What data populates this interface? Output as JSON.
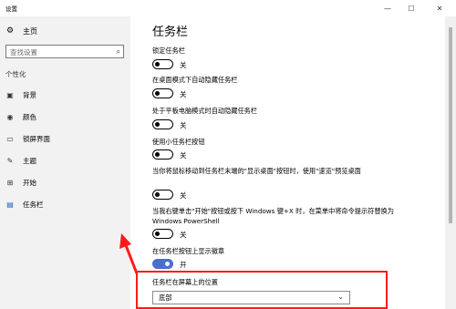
{
  "window": {
    "title": "设置"
  },
  "controls": {
    "minimize": "—",
    "maximize": "☐",
    "close": "✕"
  },
  "sidebar": {
    "home_label": "主页",
    "search_placeholder": "查找设置",
    "section": "个性化",
    "items": [
      {
        "label": "背景",
        "icon": "image-icon"
      },
      {
        "label": "颜色",
        "icon": "palette-icon"
      },
      {
        "label": "锁屏界面",
        "icon": "lock-screen-icon"
      },
      {
        "label": "主题",
        "icon": "theme-icon"
      },
      {
        "label": "开始",
        "icon": "start-icon"
      },
      {
        "label": "任务栏",
        "icon": "taskbar-icon",
        "active": true
      }
    ]
  },
  "main": {
    "title": "任务栏",
    "options": [
      {
        "label": "锁定任务栏",
        "state": "关",
        "on": false
      },
      {
        "label": "在桌面模式下自动隐藏任务栏",
        "state": "关",
        "on": false
      },
      {
        "label": "处于平板电脑模式时自动隐藏任务栏",
        "state": "关",
        "on": false
      },
      {
        "label": "使用小任务栏按钮",
        "state": "关",
        "on": false
      },
      {
        "label": "当你将鼠标移动到任务栏末端的\"显示桌面\"按钮时，使用\"速览\"预览桌面",
        "state": "关",
        "on": false
      },
      {
        "label": "当我右键单击\"开始\"按钮或按下 Windows 键+X 时，在菜单中将命令提示符替换为 Windows PowerShell",
        "state": "关",
        "on": false
      },
      {
        "label": "在任务栏按钮上显示徽章",
        "state": "开",
        "on": true
      }
    ],
    "position_label": "任务栏在屏幕上的位置",
    "position_value": "底部"
  },
  "colors": {
    "accent": "#4a6fd0",
    "highlight": "#ff1a1a"
  }
}
